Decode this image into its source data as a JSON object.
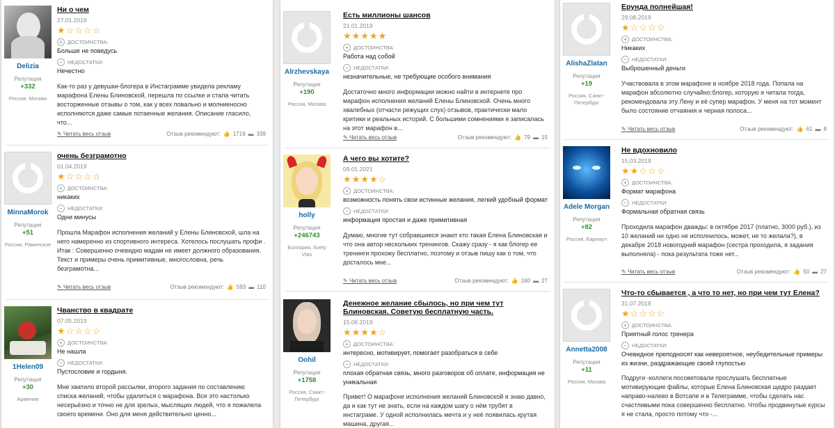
{
  "ui": {
    "advantages": "ДОСТОИНСТВА:",
    "disadvantages": "НЕДОСТАТКИ:",
    "reputation": "Репутация",
    "read_full": "Читать весь отзыв",
    "recommend": "Отзыв рекомендуют:"
  },
  "reviews": [
    {
      "user": "Delizia",
      "rep": "+332",
      "location": "Россия, Москва",
      "title": "Ни о чем",
      "date": "27.01.2019",
      "stars": "★☆☆☆☆",
      "pros": "Больше не поведусь",
      "cons": "Нечестно",
      "text": "Как-то раз у девушки-блогера в Инстаграмме увидела рекламу марафона Елены Блиновской, перешла по ссылке и стала читать восторженные отзывы о том, как у всех повально и молниеносно исполняются даже самые потаенные желания. Описание гласило, что...",
      "likes": "1719",
      "comments": "339"
    },
    {
      "user": "MinnaMorok",
      "rep": "+51",
      "location": "Россия, Раменское",
      "title": "очень безграмотно",
      "date": "01.04.2019",
      "stars": "★☆☆☆☆",
      "pros": "никаких",
      "cons": "Одни минусы",
      "text": "Прошла Марафон исполнения желаний у Елены Блиновской, шла на него намеренно из спортивного интереса. Хотелось послушать профи . Итак : Совершенно очевидно мадам не имеет должного образования. Текст и примеры очень примитивные, многословна, речь безграмотна...",
      "likes": "593",
      "comments": "110"
    },
    {
      "user": "1Helen09",
      "rep": "+30",
      "location": "Армения",
      "title": "Чванство в квадрате",
      "date": "07.05.2019",
      "stars": "★☆☆☆☆",
      "pros": "Не нашла",
      "cons": "Пустословие и гордыня.",
      "text": "Мне хватило второй рассылки, второго задания по составлению списка желаний, чтобы удалиться с марафона. Все это настолько несерьёзно и точно не для зрелых, мыслящих людей, что я пожалела своего времени. Оно для меня действительно ценно...",
      "likes": "",
      "comments": ""
    },
    {
      "user": "Alrzhevskaya",
      "rep": "+190",
      "location": "Россия, Москва",
      "title": "Есть миллионы шансов",
      "date": "21.01.2019",
      "stars": "★★★★★",
      "pros": "Работа над собой",
      "cons": "незначительные, не требующие особого внимания",
      "text": "Достаточно много информации можно найти в интернете про марафон исполнения желаний Елены Блиновской. Очень много хвалебных (отчасти режущих слух) отзывов, практически мало критики и реальных историй. С большими сомнениями я записалась на этот марафон в...",
      "likes": "79",
      "comments": "15"
    },
    {
      "user": "holly",
      "rep": "+246743",
      "location": "Болгария, Svety Vlas",
      "title": "А чего вы хотите?",
      "date": "09.01.2021",
      "stars": "★★★★☆",
      "pros": "возможность понять свои истинные желания, легкий удобный формат",
      "cons": "информация простая и даже примитивная",
      "text": "Думаю, многие тут собравшиеся знают кто такая Елена Блиновская и что она автор нескольких тренингов. Скажу сразу - я как блогер ее тренинги прохожу бесплатно, поэтому и отзыв пишу как о том, что досталось мне...",
      "likes": "160",
      "comments": "27"
    },
    {
      "user": "Oohil",
      "rep": "+1758",
      "location": "Россия, Санкт-Петербург",
      "title": "Денежное желание сбылось, но при чем тут Блиновская. Советую бесплатную часть.",
      "date": "15.06.2019",
      "stars": "★★★★☆",
      "pros": "интересно, мотивирует, помогает разобраться в себе",
      "cons": "плохая обратная связь, много разговоров об оплате, информация не уникальная",
      "text": "Привет! О марафоне исполнения желаний Блиновской я знаю давно, да и как тут не знать, если на каждом шагу о нём трубят в инстаграме. У одной исполнилась мечта и у неё появилась крутая машина, другая...",
      "likes": "",
      "comments": ""
    },
    {
      "user": "AlishaZlatan",
      "rep": "+19",
      "location": "Россия, Санкт-Петербург",
      "title": "Ерунда полнейшая!",
      "date": "29.08.2019",
      "stars": "★☆☆☆☆",
      "pros": "Никаких",
      "cons": "Выброшенный деньги",
      "text": "Участвовала в этом марафоне в ноябре 2018 года. Попала на марафон абсолютно случайно:блогер, которую я читала тогда, рекомендовала эту Лену и её супер марафон. У меня на тот момент было состояние отчаяния и черная полоса...",
      "likes": "61",
      "comments": "8"
    },
    {
      "user": "Adele Morgan",
      "rep": "+82",
      "location": "Россия, Барнаул",
      "title": "Не вдохновило",
      "date": "15.03.2019",
      "stars": "★★☆☆☆",
      "pros": "Формат марафона",
      "cons": "Формальная обратная связь",
      "text": "Проходила марафон дважды: в октябре 2017 (платно, 3000 руб.), из 10 желаний ни одно не исполнилось, может, не то желала?), в декабре 2018 новогодний марафон (сестра проходила, я задания выполняла) - пока результата тоже нет...",
      "likes": "50",
      "comments": "27"
    },
    {
      "user": "Annetta2008",
      "rep": "+11",
      "location": "Россия, Москва",
      "title": "Что-то сбывается , а что то нет, но при чем тут Елена?",
      "date": "31.07.2019",
      "stars": "★☆☆☆☆",
      "pros": "Приятный голос тренера",
      "cons": "Очевидное преподносят как невероятное, неубедительные примеры из жизни, раздражающие своей глупостью",
      "text": "Подруги -коллеги посоветовали прослушать бесплатные мотивирующие файлы, которые Елена Блиновская щедро раздает направо-налево в Вотсапе и в Телеграмме, чтобы сделать нас счастливыми пока совершенно бесплатно. Чтобы продвинутые курсы я не стала, просто потому что -...",
      "likes": "",
      "comments": ""
    }
  ]
}
